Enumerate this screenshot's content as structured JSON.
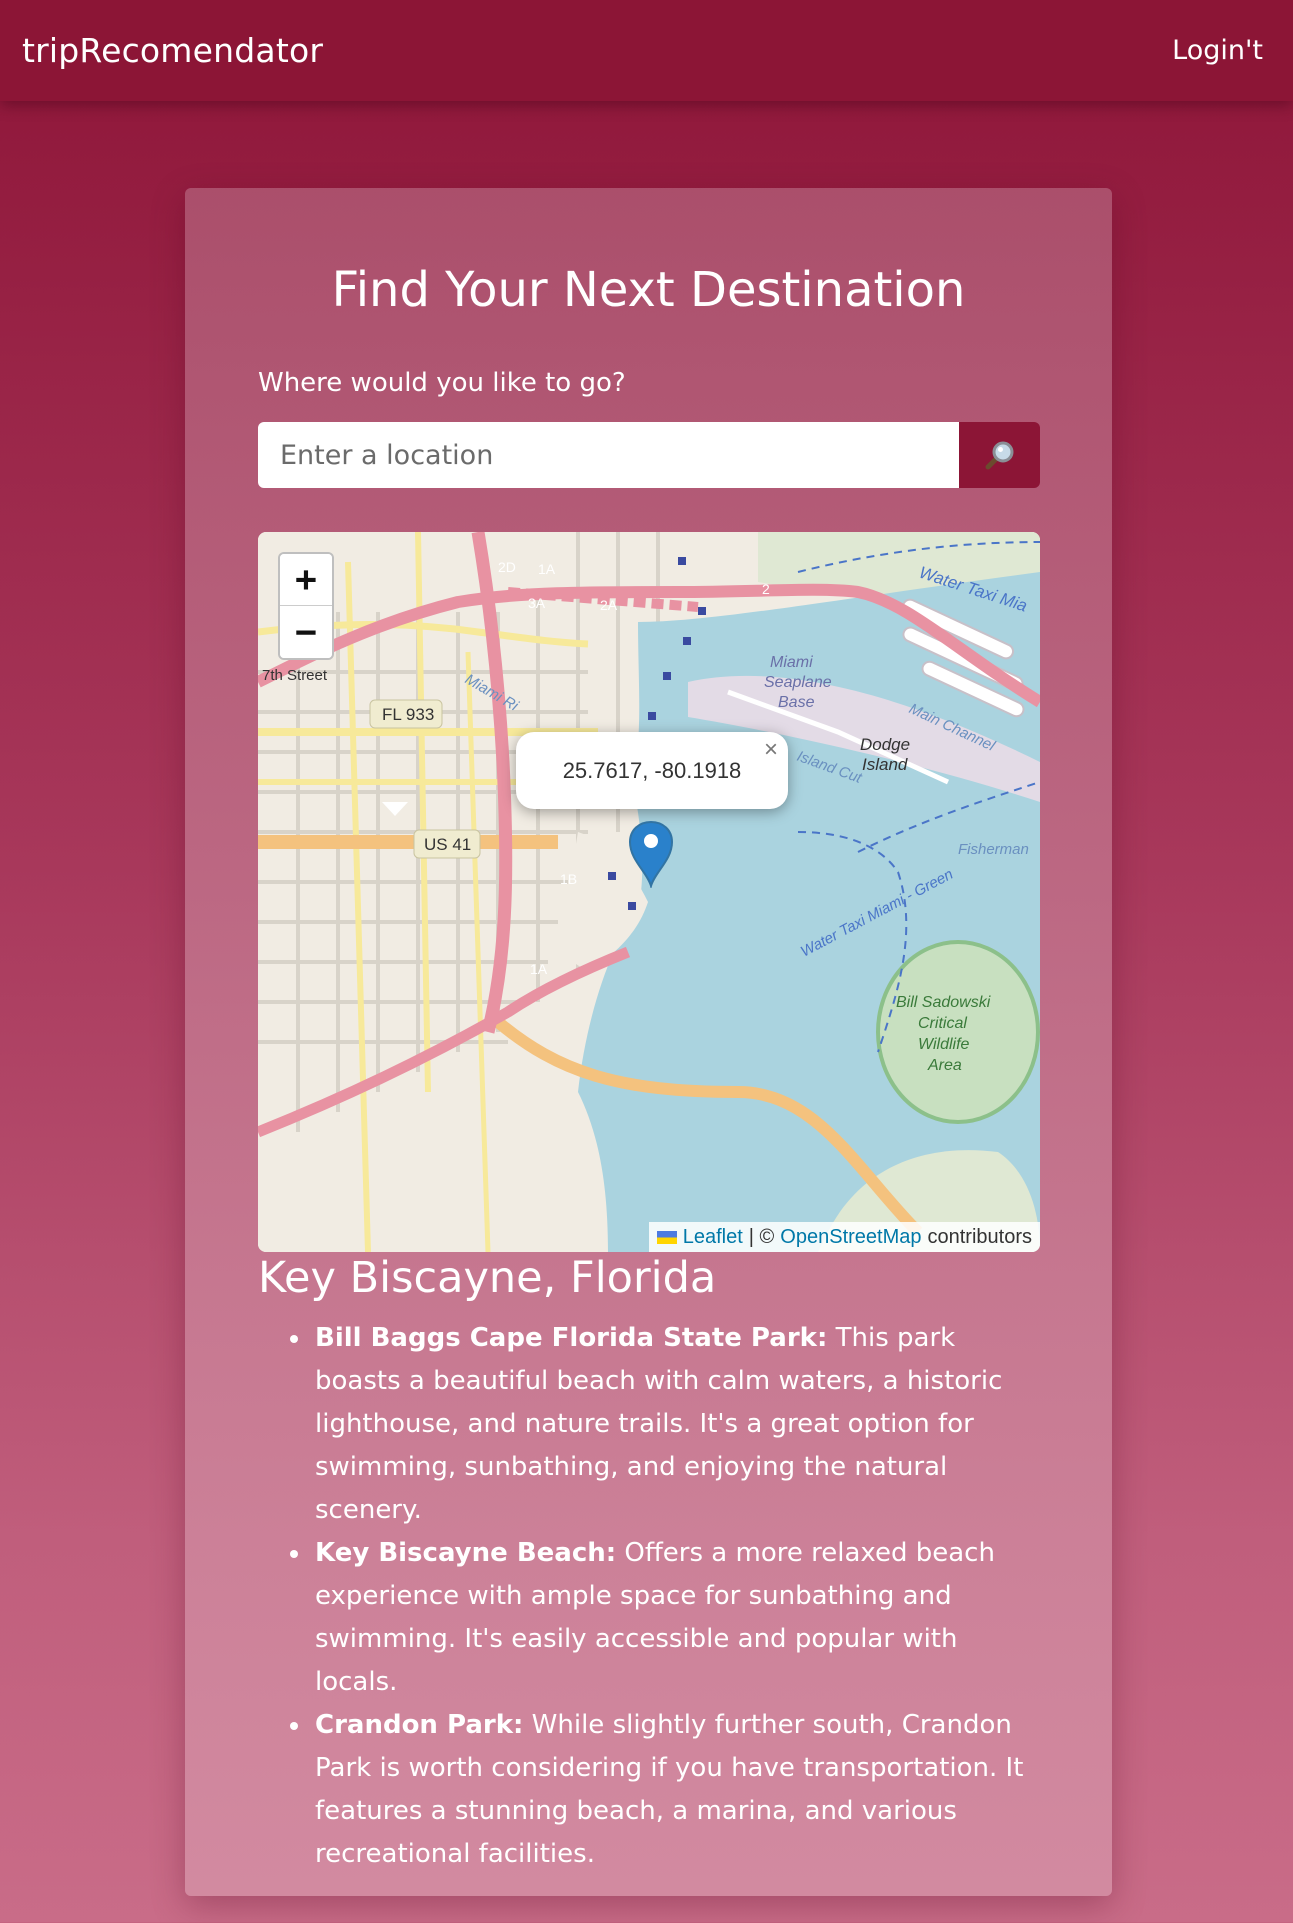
{
  "navbar": {
    "brand": "tripRecomendator",
    "login_label": "Login't"
  },
  "search": {
    "title": "Find Your Next Destination",
    "label": "Where would you like to go?",
    "placeholder": "Enter a location",
    "button_icon": "magnifier-icon"
  },
  "map": {
    "zoom_in_label": "+",
    "zoom_out_label": "−",
    "popup_text": "25.7617, -80.1918",
    "popup_close": "×",
    "marker_icon": "map-pin-icon",
    "attribution": {
      "leaflet": "Leaflet",
      "separator": "| ©",
      "osm": "OpenStreetMap",
      "suffix": "contributors"
    },
    "labels": {
      "street_7th": "7th Street",
      "fl933": "FL 933",
      "us41": "US 41",
      "miami_river": "Miami Ri",
      "seaplane_1": "Miami",
      "seaplane_2": "Seaplane",
      "seaplane_3": "Base",
      "dodge_1": "Dodge",
      "dodge_2": "Island",
      "island_cut": "Island Cut",
      "main_channel": "Main Channel",
      "water_taxi_top": "Water Taxi Mia",
      "water_taxi_green": "Water Taxi Miami - Green",
      "fisherman": "Fisherman",
      "bill_1": "Bill Sadowski",
      "bill_2": "Critical",
      "bill_3": "Wildlife",
      "bill_4": "Area",
      "r2a": "2A",
      "r1a": "1A",
      "r3a": "3A",
      "r2d": "2D",
      "r2": "2",
      "r1b": "1B",
      "r1a_south": "1A"
    }
  },
  "destination": {
    "title": "Key Biscayne, Florida",
    "places": [
      {
        "name": "Bill Baggs Cape Florida State Park:",
        "description": " This park boasts a beautiful beach with calm waters, a historic lighthouse, and nature trails. It's a great option for swimming, sunbathing, and enjoying the natural scenery."
      },
      {
        "name": "Key Biscayne Beach:",
        "description": " Offers a more relaxed beach experience with ample space for sunbathing and swimming. It's easily accessible and popular with locals."
      },
      {
        "name": "Crandon Park:",
        "description": " While slightly further south, Crandon Park is worth considering if you have transportation. It features a stunning beach, a marina, and various recreational facilities."
      }
    ]
  },
  "colors": {
    "navbar": "#8c1536",
    "search_button": "#8c1536",
    "marker": "#2a81cb",
    "link": "#0078a8"
  }
}
